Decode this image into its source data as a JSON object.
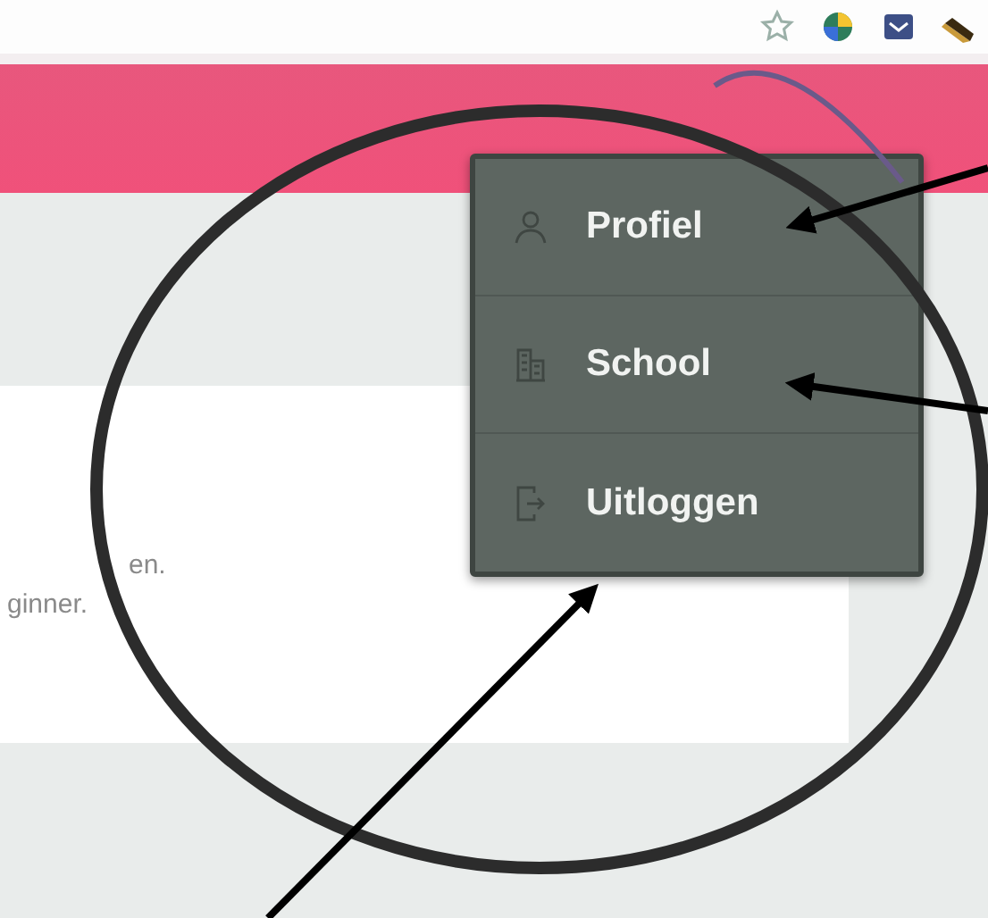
{
  "page_text": [
    "en.",
    "ginner."
  ],
  "menu": {
    "items": [
      {
        "label": "Profiel",
        "kind": "person"
      },
      {
        "label": "School",
        "kind": "building"
      },
      {
        "label": "Uitloggen",
        "kind": "logout"
      }
    ]
  }
}
